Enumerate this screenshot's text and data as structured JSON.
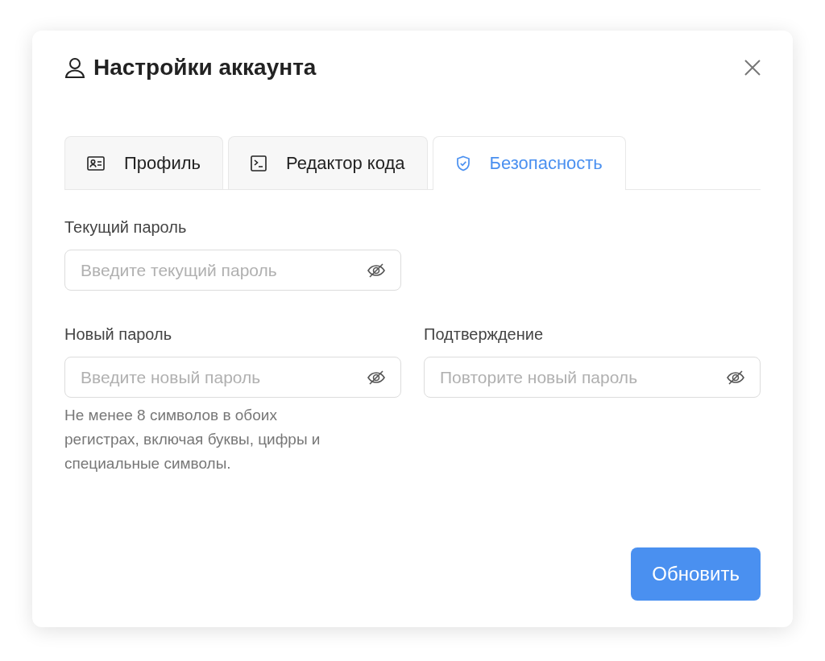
{
  "dialog": {
    "title": "Настройки аккаунта",
    "tabs": [
      {
        "label": "Профиль",
        "selected": false
      },
      {
        "label": "Редактор кода",
        "selected": false
      },
      {
        "label": "Безопасность",
        "selected": true
      }
    ],
    "field_rows": [
      [
        {
          "label": "Текущий пароль",
          "placeholder": "Введите текущий пароль"
        }
      ],
      [
        {
          "label": "Новый пароль",
          "placeholder": "Введите новый пароль",
          "hint": "Не менее 8 символов в обоих регистрах, включая буквы, цифры и специальные символы."
        },
        {
          "label": "Подтверждение",
          "placeholder": "Повторите новый пароль"
        }
      ]
    ],
    "submit_button": "Обновить"
  }
}
